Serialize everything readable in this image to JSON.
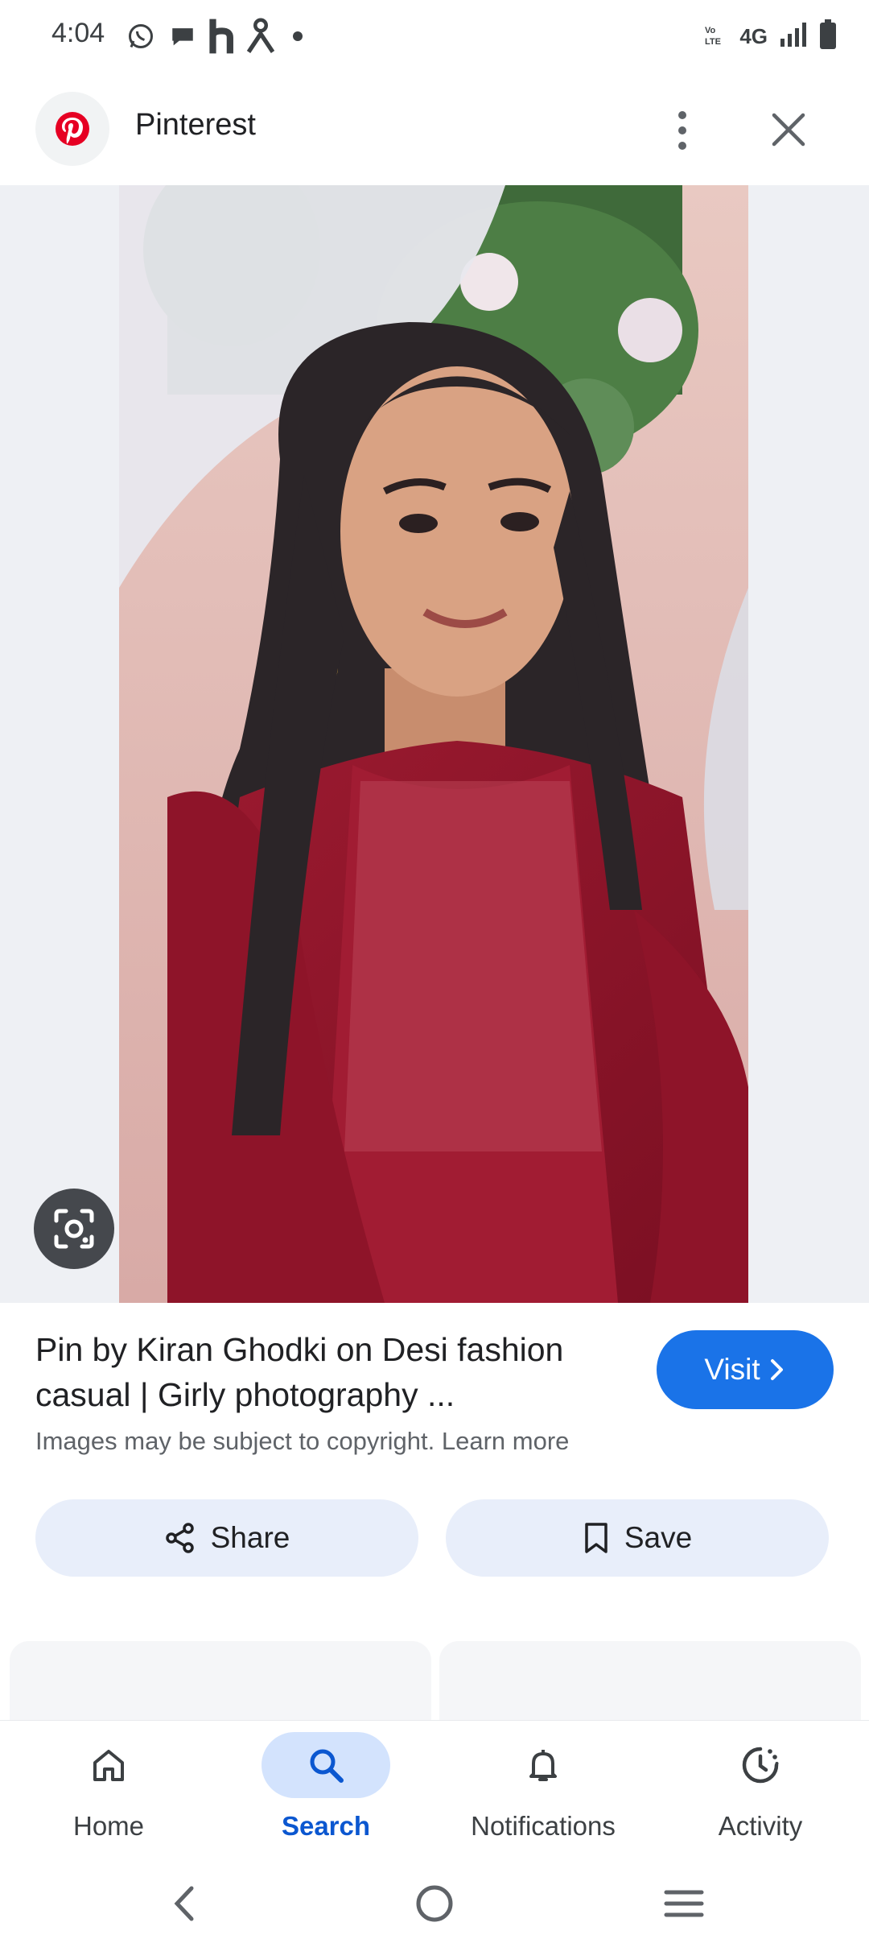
{
  "status_bar": {
    "time": "4:04",
    "notification_icons": [
      "whatsapp-icon",
      "chat-icon",
      "h-app-icon",
      "person-app-icon",
      "dot-icon"
    ],
    "network": "4G",
    "icons": [
      "volte-icon",
      "signal-icon",
      "battery-icon"
    ]
  },
  "header": {
    "site_name": "Pinterest",
    "logo_icon": "pinterest-logo",
    "logo_color": "#e60023"
  },
  "result": {
    "title": "Pin by Kiran Ghodki on Desi fashion casual | Girly photography ...",
    "copyright_note": "Images may be subject to copyright. Learn more",
    "visit_label": "Visit"
  },
  "actions": {
    "share_label": "Share",
    "save_label": "Save"
  },
  "bottom_nav": {
    "items": [
      {
        "label": "Home",
        "icon": "home-icon",
        "active": false
      },
      {
        "label": "Search",
        "icon": "search-icon",
        "active": true
      },
      {
        "label": "Notifications",
        "icon": "bell-icon",
        "active": false
      },
      {
        "label": "Activity",
        "icon": "activity-icon",
        "active": false
      }
    ]
  },
  "colors": {
    "accent": "#1a73e8",
    "active_nav": "#0b57d0",
    "active_nav_bg": "#d3e3fd",
    "pill_bg": "#e8eefa"
  }
}
